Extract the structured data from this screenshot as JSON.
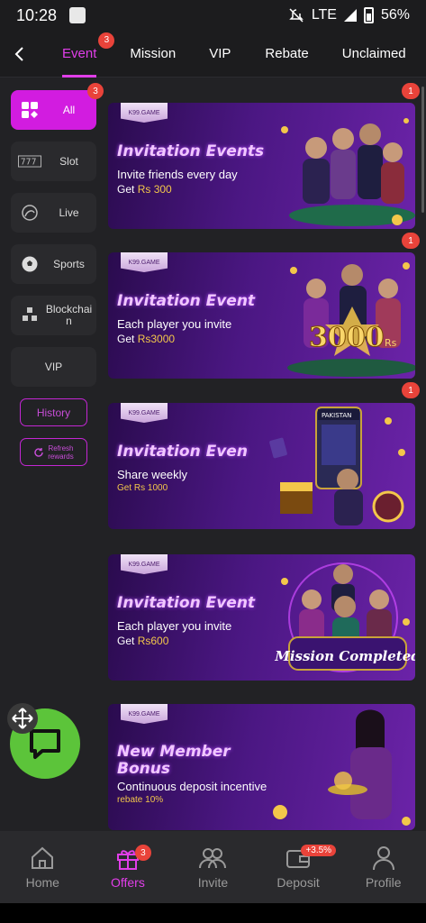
{
  "status_bar": {
    "time": "10:28",
    "network": "LTE",
    "battery": "56%"
  },
  "top_nav": {
    "tabs": [
      {
        "label": "Event",
        "badge": "3"
      },
      {
        "label": "Mission"
      },
      {
        "label": "VIP"
      },
      {
        "label": "Rebate"
      },
      {
        "label": "Unclaimed"
      }
    ]
  },
  "sidebar": {
    "categories": [
      {
        "label": "All",
        "badge": "3",
        "icon": "grid-icon"
      },
      {
        "label": "Slot",
        "icon": "slot-777-icon"
      },
      {
        "label": "Live",
        "icon": "live-dealer-icon"
      },
      {
        "label": "Sports",
        "icon": "soccer-ball-icon"
      },
      {
        "label": "Blockchain",
        "icon": "blockchain-icon"
      },
      {
        "label": "VIP"
      }
    ],
    "history_label": "History",
    "refresh_label_1": "Refresh",
    "refresh_label_2": "rewards"
  },
  "banners": [
    {
      "tag": "K99.GAME",
      "title": "Invitation Events",
      "subtitle": "Invite friends every day",
      "reward_prefix": "Get ",
      "reward_value": "Rs 300",
      "badge": "1"
    },
    {
      "tag": "K99.GAME",
      "title": "Invitation Event",
      "subtitle": "Each player you invite",
      "reward_prefix": "Get ",
      "reward_value": "Rs3000",
      "art_text": "3000",
      "art_unit": "Rs",
      "badge": "1"
    },
    {
      "tag": "K99.GAME",
      "title": "Invitation Even",
      "subtitle": "Share weekly",
      "reward_prefix": "",
      "reward_value": "Get Rs 1000",
      "art_text": "PAKISTAN",
      "badge": "1"
    },
    {
      "tag": "K99.GAME",
      "title": "Invitation Event",
      "subtitle": "Each player you invite",
      "reward_prefix": "Get ",
      "reward_value": "Rs600",
      "art_text": "Mission Completed"
    },
    {
      "tag": "K99.GAME",
      "title": "New Member Bonus",
      "subtitle": "Continuous deposit incentive",
      "reward_prefix": "",
      "reward_value": "rebate 10%"
    }
  ],
  "bottom_nav": {
    "items": [
      {
        "label": "Home"
      },
      {
        "label": "Offers",
        "badge": "3"
      },
      {
        "label": "Invite"
      },
      {
        "label": "Deposit",
        "badge": "+3.5%"
      },
      {
        "label": "Profile"
      }
    ]
  },
  "colors": {
    "accent": "#e13ee9",
    "badge": "#e9433a",
    "chat": "#5cc43a",
    "gold": "#f3c74a"
  }
}
